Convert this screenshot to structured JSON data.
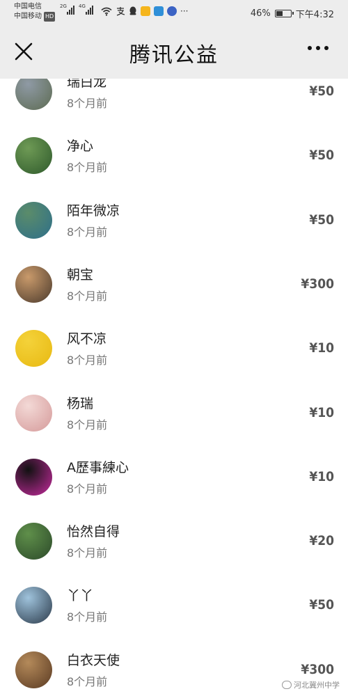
{
  "status_bar": {
    "carrier_1": "中国电信",
    "carrier_2": "中国移动",
    "hd_badge": "HD",
    "signal_1_tag": "2G",
    "signal_2_tag": "4G",
    "battery_percent": "46%",
    "battery_level": 0.46,
    "time": "下午4:32"
  },
  "nav": {
    "title": "腾讯公益"
  },
  "donations": [
    {
      "name": "瑞白龙",
      "time": "8个月前",
      "amount": "¥50",
      "avatar_colors": [
        "#8f9aa5",
        "#5d6b52"
      ]
    },
    {
      "name": "净心",
      "time": "8个月前",
      "amount": "¥50",
      "avatar_colors": [
        "#6e9a55",
        "#2f5a2c"
      ]
    },
    {
      "name": "陌年微凉",
      "time": "8个月前",
      "amount": "¥50",
      "avatar_colors": [
        "#5b8c6a",
        "#2e6f8a"
      ]
    },
    {
      "name": "朝宝",
      "time": "8个月前",
      "amount": "¥300",
      "avatar_colors": [
        "#c99a6b",
        "#4b3a2c"
      ]
    },
    {
      "name": "风不凉",
      "time": "8个月前",
      "amount": "¥10",
      "avatar_colors": [
        "#f4d23a",
        "#e8b912"
      ]
    },
    {
      "name": "杨瑞",
      "time": "8个月前",
      "amount": "¥10",
      "avatar_colors": [
        "#f3d9d6",
        "#d59a9a"
      ]
    },
    {
      "name": "A歷事練心",
      "time": "8个月前",
      "amount": "¥10",
      "avatar_colors": [
        "#111111",
        "#c62b9e"
      ]
    },
    {
      "name": "怡然自得",
      "time": "8个月前",
      "amount": "¥20",
      "avatar_colors": [
        "#5f8f4a",
        "#2c4a2a"
      ]
    },
    {
      "name": "丫丫",
      "time": "8个月前",
      "amount": "¥50",
      "avatar_colors": [
        "#9fc3dc",
        "#2b3a4a"
      ]
    },
    {
      "name": "白衣天使",
      "time": "8个月前",
      "amount": "¥300",
      "avatar_colors": [
        "#b48a5a",
        "#5a3a22"
      ]
    }
  ],
  "watermark": {
    "text": "河北冀州中学"
  }
}
